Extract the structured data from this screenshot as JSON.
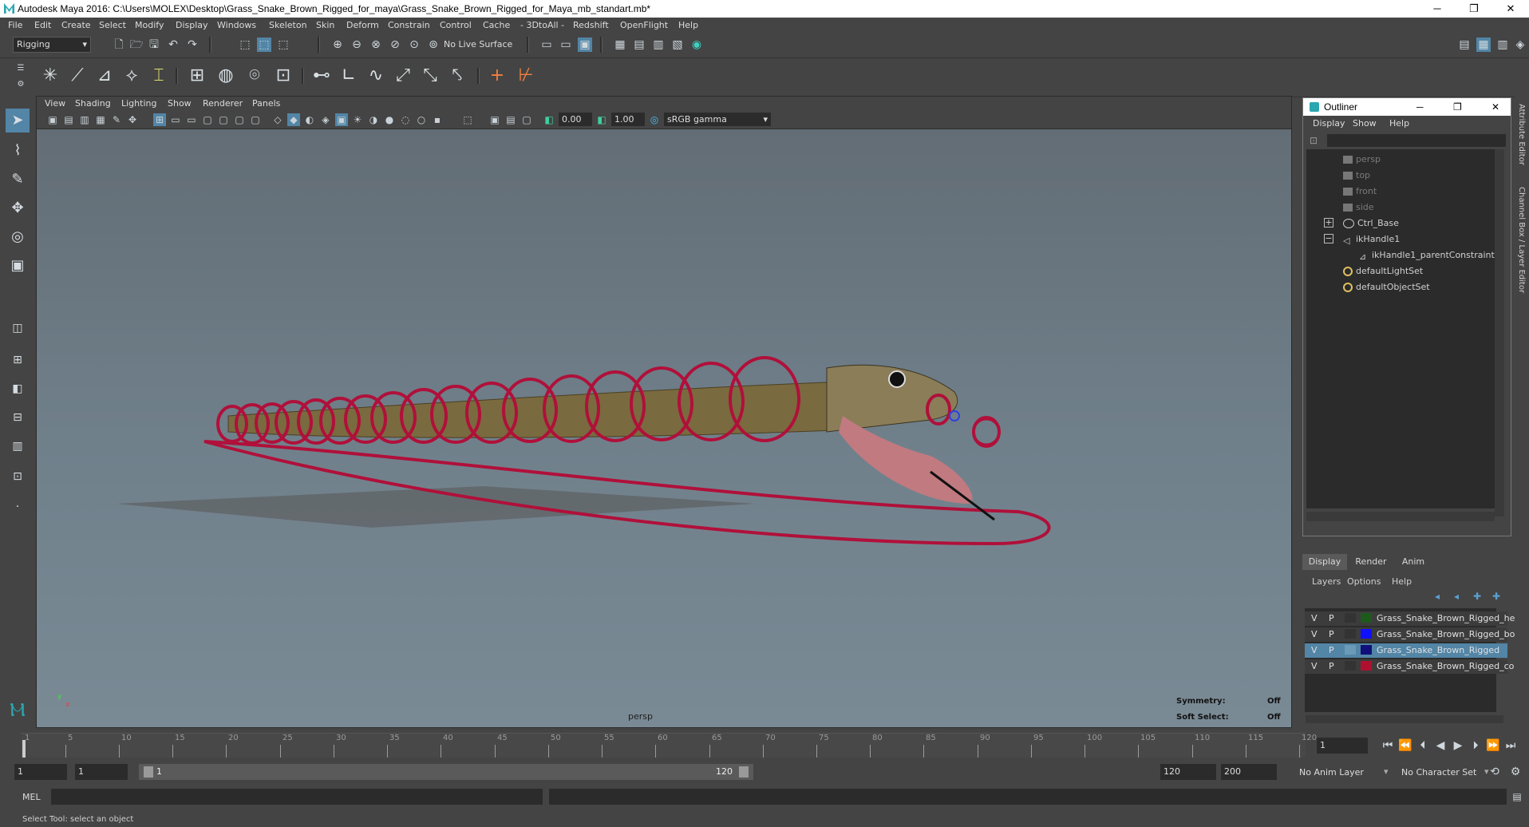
{
  "window": {
    "title": "Autodesk Maya 2016: C:\\Users\\MOLEX\\Desktop\\Grass_Snake_Brown_Rigged_for_maya\\Grass_Snake_Brown_Rigged_for_Maya_mb_standart.mb*",
    "minimize": "─",
    "restore": "❐",
    "close": "✕"
  },
  "menu": [
    "File",
    "Edit",
    "Create",
    "Select",
    "Modify",
    "Display",
    "Windows",
    "Skeleton",
    "Skin",
    "Deform",
    "Constrain",
    "Control",
    "Cache",
    "- 3DtoAll -",
    "Redshift",
    "OpenFlight",
    "Help"
  ],
  "status_line": {
    "mode": "Rigging",
    "live_surface": "No Live Surface"
  },
  "viewport": {
    "menu": [
      "View",
      "Shading",
      "Lighting",
      "Show",
      "Renderer",
      "Panels"
    ],
    "exposure": "0.00",
    "gamma": "1.00",
    "color_space": "sRGB gamma",
    "camera_label": "persp",
    "symmetry_label": "Symmetry:",
    "symmetry_value": "Off",
    "soft_select_label": "Soft Select:",
    "soft_select_value": "Off",
    "axis_y": "y",
    "axis_x": "x"
  },
  "outliner": {
    "title": "Outliner",
    "menu": [
      "Display",
      "Show",
      "Help"
    ],
    "items": [
      {
        "label": "persp",
        "dim": true
      },
      {
        "label": "top",
        "dim": true
      },
      {
        "label": "front",
        "dim": true
      },
      {
        "label": "side",
        "dim": true
      },
      {
        "label": "Ctrl_Base",
        "dim": false,
        "expander": "+"
      },
      {
        "label": "ikHandle1",
        "dim": false,
        "expander": "−"
      },
      {
        "label": "ikHandle1_parentConstraint1",
        "dim": false
      },
      {
        "label": "defaultLightSet",
        "dim": false
      },
      {
        "label": "defaultObjectSet",
        "dim": false
      }
    ]
  },
  "layer_editor": {
    "tabs": [
      "Display",
      "Render",
      "Anim"
    ],
    "menu": [
      "Layers",
      "Options",
      "Help"
    ],
    "layers": [
      {
        "v": "V",
        "p": "P",
        "color": "#1e5a1e",
        "name": "Grass_Snake_Brown_Rigged_hel",
        "selected": false
      },
      {
        "v": "V",
        "p": "P",
        "color": "#1010ff",
        "name": "Grass_Snake_Brown_Rigged_bor",
        "selected": false
      },
      {
        "v": "V",
        "p": "P",
        "color": "#10107a",
        "name": "Grass_Snake_Brown_Rigged",
        "selected": true
      },
      {
        "v": "V",
        "p": "P",
        "color": "#b01030",
        "name": "Grass_Snake_Brown_Rigged_cor",
        "selected": false
      }
    ]
  },
  "timeline": {
    "ticks": [
      1,
      5,
      10,
      15,
      20,
      25,
      30,
      35,
      40,
      45,
      50,
      55,
      60,
      65,
      70,
      75,
      80,
      85,
      90,
      95,
      100,
      105,
      110,
      115,
      120
    ],
    "current_frame": "1"
  },
  "range": {
    "start": "1",
    "playback_start": "1",
    "slider_start": "1",
    "slider_end": "120",
    "playback_end": "120",
    "end": "200",
    "anim_layer": "No Anim Layer",
    "character_set": "No Character Set"
  },
  "command_line": {
    "label": "MEL"
  },
  "status": {
    "help_text": "Select Tool: select an object"
  },
  "side_tabs": {
    "attribute_editor": "Attribute Editor",
    "channel_box": "Channel Box / Layer Editor"
  },
  "colors": {
    "accent_selected": "#5285a6",
    "control_curves": "#b0103a",
    "ui_bg": "#444444"
  }
}
